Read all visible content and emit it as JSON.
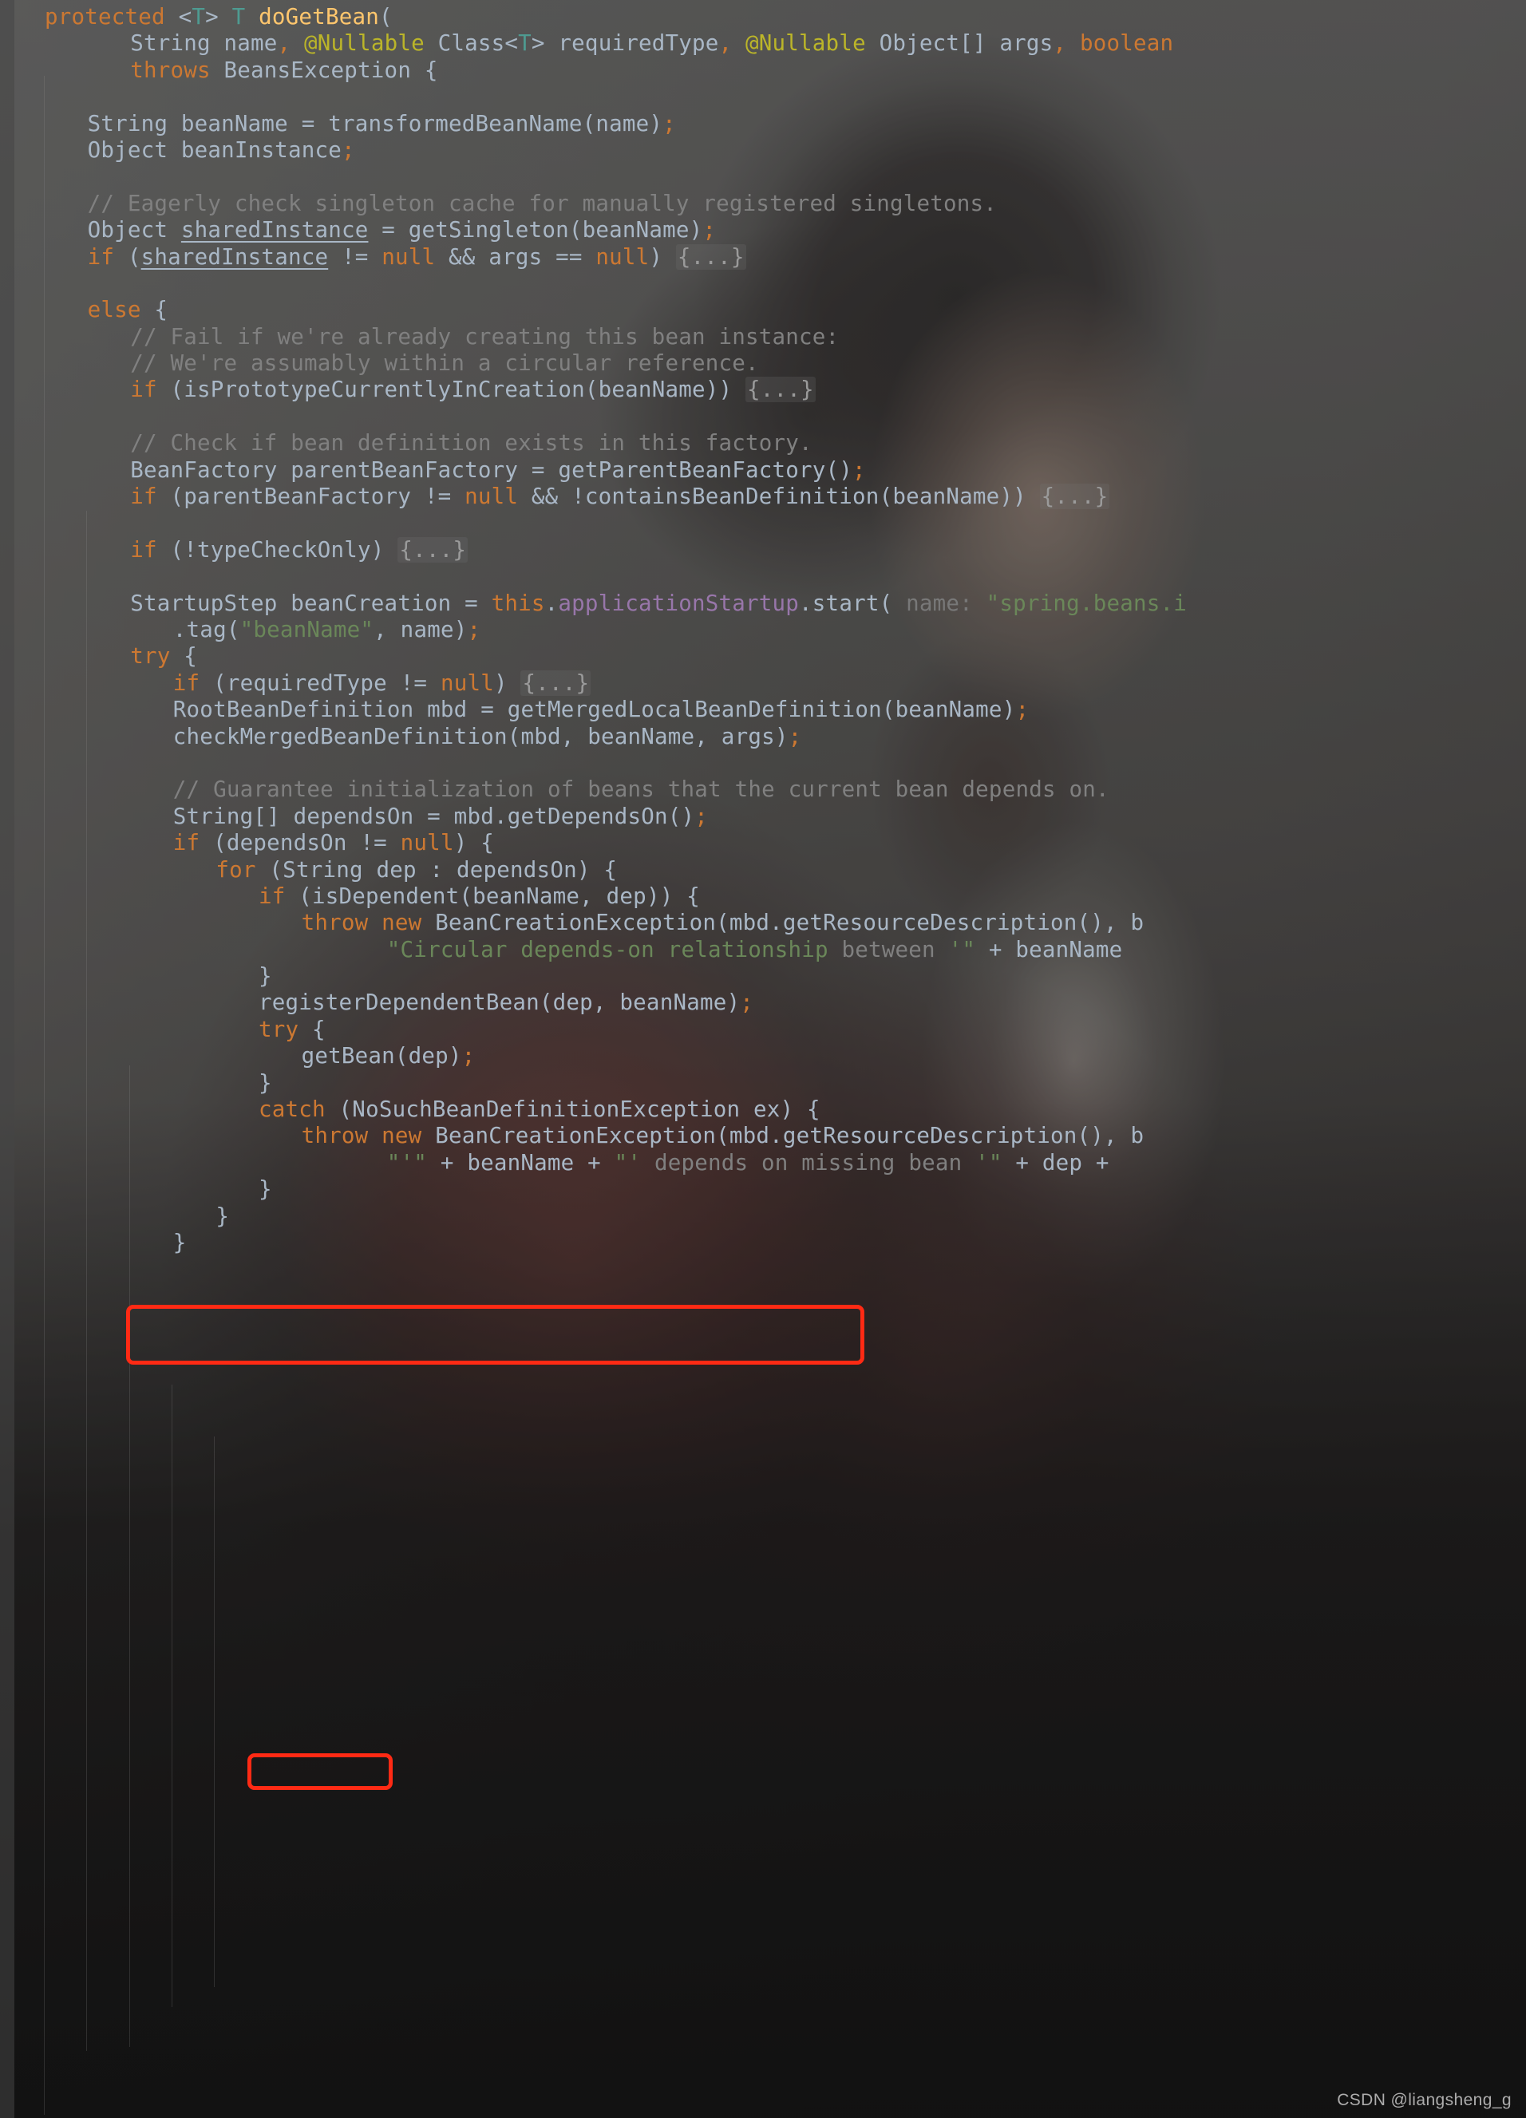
{
  "app": {
    "kind": "code-editor",
    "language": "Java",
    "theme": "Darcula",
    "watermark": "CSDN @liangsheng_g"
  },
  "colors": {
    "background": "#3c3f41",
    "default_text": "#a9b7c6",
    "keyword": "#cc7832",
    "method": "#ffc66d",
    "annotation": "#bbb529",
    "comment": "#808080",
    "string": "#6a8759",
    "field": "#9876aa",
    "type": "#4e9b91",
    "highlight_box": "#ff2a14"
  },
  "annotations": [
    {
      "name": "dependson-highlight",
      "label": "red box around depends-on comment and getDependsOn call",
      "color": "#ff2a14"
    },
    {
      "name": "getbean-highlight",
      "label": "red box around getBean(dep); call",
      "color": "#ff2a14"
    }
  ],
  "code": {
    "lines": [
      {
        "i": 0,
        "indent": 0,
        "tokens": [
          {
            "t": "protected ",
            "c": "kw"
          },
          {
            "t": "<",
            "c": "pl"
          },
          {
            "t": "T",
            "c": "typ"
          },
          {
            "t": "> ",
            "c": "pl"
          },
          {
            "t": "T",
            "c": "typ"
          },
          {
            "t": " ",
            "c": "pl"
          },
          {
            "t": "doGetBean",
            "c": "mth"
          },
          {
            "t": "(",
            "c": "pl"
          }
        ]
      },
      {
        "i": 1,
        "indent": 4,
        "tokens": [
          {
            "t": "String name",
            "c": "pl"
          },
          {
            "t": ", ",
            "c": "kw"
          },
          {
            "t": "@Nullable",
            "c": "ann"
          },
          {
            "t": " Class<",
            "c": "pl"
          },
          {
            "t": "T",
            "c": "typ"
          },
          {
            "t": "> requiredType",
            "c": "pl"
          },
          {
            "t": ", ",
            "c": "kw"
          },
          {
            "t": "@Nullable",
            "c": "ann"
          },
          {
            "t": " Object[] args",
            "c": "pl"
          },
          {
            "t": ", ",
            "c": "kw"
          },
          {
            "t": "boolean",
            "c": "kw"
          }
        ]
      },
      {
        "i": 2,
        "indent": 4,
        "tokens": [
          {
            "t": "throws ",
            "c": "kw"
          },
          {
            "t": "BeansException {",
            "c": "pl"
          }
        ]
      },
      {
        "i": 3,
        "indent": 0,
        "tokens": []
      },
      {
        "i": 4,
        "indent": 2,
        "tokens": [
          {
            "t": "String beanName = transformedBeanName(name)",
            "c": "pl"
          },
          {
            "t": ";",
            "c": "kw"
          }
        ]
      },
      {
        "i": 5,
        "indent": 2,
        "tokens": [
          {
            "t": "Object beanInstance",
            "c": "pl"
          },
          {
            "t": ";",
            "c": "kw"
          }
        ]
      },
      {
        "i": 6,
        "indent": 0,
        "tokens": []
      },
      {
        "i": 7,
        "indent": 2,
        "tokens": [
          {
            "t": "// Eagerly check singleton cache for manually registered singletons.",
            "c": "cm"
          }
        ]
      },
      {
        "i": 8,
        "indent": 2,
        "tokens": [
          {
            "t": "Object ",
            "c": "pl"
          },
          {
            "t": "sharedInstance",
            "c": "und"
          },
          {
            "t": " = getSingleton(beanName)",
            "c": "pl"
          },
          {
            "t": ";",
            "c": "kw"
          }
        ]
      },
      {
        "i": 9,
        "indent": 2,
        "tokens": [
          {
            "t": "if",
            "c": "kw"
          },
          {
            "t": " (",
            "c": "pl"
          },
          {
            "t": "sharedInstance",
            "c": "und"
          },
          {
            "t": " != ",
            "c": "pl"
          },
          {
            "t": "null",
            "c": "kw"
          },
          {
            "t": " && args == ",
            "c": "pl"
          },
          {
            "t": "null",
            "c": "kw"
          },
          {
            "t": ") ",
            "c": "pl"
          },
          {
            "t": "{...}",
            "c": "fold"
          }
        ]
      },
      {
        "i": 10,
        "indent": 0,
        "tokens": []
      },
      {
        "i": 11,
        "indent": 2,
        "tokens": [
          {
            "t": "else",
            "c": "kw"
          },
          {
            "t": " {",
            "c": "pl"
          }
        ]
      },
      {
        "i": 12,
        "indent": 4,
        "tokens": [
          {
            "t": "// Fail if we're already creating this bean instance:",
            "c": "cm"
          }
        ]
      },
      {
        "i": 13,
        "indent": 4,
        "tokens": [
          {
            "t": "// We're assumably within a circular reference.",
            "c": "cm"
          }
        ]
      },
      {
        "i": 14,
        "indent": 4,
        "tokens": [
          {
            "t": "if",
            "c": "kw"
          },
          {
            "t": " (isPrototypeCurrentlyInCreation(beanName)) ",
            "c": "pl"
          },
          {
            "t": "{...}",
            "c": "fold"
          }
        ]
      },
      {
        "i": 15,
        "indent": 0,
        "tokens": []
      },
      {
        "i": 16,
        "indent": 4,
        "tokens": [
          {
            "t": "// Check if bean definition exists in this factory.",
            "c": "cm"
          }
        ]
      },
      {
        "i": 17,
        "indent": 4,
        "tokens": [
          {
            "t": "BeanFactory parentBeanFactory = getParentBeanFactory()",
            "c": "pl"
          },
          {
            "t": ";",
            "c": "kw"
          }
        ]
      },
      {
        "i": 18,
        "indent": 4,
        "tokens": [
          {
            "t": "if",
            "c": "kw"
          },
          {
            "t": " (parentBeanFactory != ",
            "c": "pl"
          },
          {
            "t": "null",
            "c": "kw"
          },
          {
            "t": " && !containsBeanDefinition(beanName)) ",
            "c": "pl"
          },
          {
            "t": "{...}",
            "c": "fold"
          }
        ]
      },
      {
        "i": 19,
        "indent": 0,
        "tokens": []
      },
      {
        "i": 20,
        "indent": 4,
        "tokens": [
          {
            "t": "if",
            "c": "kw"
          },
          {
            "t": " (!typeCheckOnly) ",
            "c": "pl"
          },
          {
            "t": "{...}",
            "c": "fold"
          }
        ]
      },
      {
        "i": 21,
        "indent": 0,
        "tokens": []
      },
      {
        "i": 22,
        "indent": 4,
        "tokens": [
          {
            "t": "StartupStep beanCreation = ",
            "c": "pl"
          },
          {
            "t": "this",
            "c": "kw"
          },
          {
            "t": ".",
            "c": "pl"
          },
          {
            "t": "applicationStartup",
            "c": "fld"
          },
          {
            "t": ".start(",
            "c": "pl"
          },
          {
            "t": " name: ",
            "c": "hint"
          },
          {
            "t": "\"spring.beans.i",
            "c": "str"
          }
        ]
      },
      {
        "i": 23,
        "indent": 6,
        "tokens": [
          {
            "t": ".tag(",
            "c": "pl"
          },
          {
            "t": "\"beanName\"",
            "c": "str"
          },
          {
            "t": ", name)",
            "c": "pl"
          },
          {
            "t": ";",
            "c": "kw"
          }
        ]
      },
      {
        "i": 24,
        "indent": 4,
        "tokens": [
          {
            "t": "try",
            "c": "kw"
          },
          {
            "t": " {",
            "c": "pl"
          }
        ]
      },
      {
        "i": 25,
        "indent": 6,
        "tokens": [
          {
            "t": "if",
            "c": "kw"
          },
          {
            "t": " (requiredType != ",
            "c": "pl"
          },
          {
            "t": "null",
            "c": "kw"
          },
          {
            "t": ") ",
            "c": "pl"
          },
          {
            "t": "{...}",
            "c": "fold"
          }
        ]
      },
      {
        "i": 26,
        "indent": 6,
        "tokens": [
          {
            "t": "RootBeanDefinition mbd = getMergedLocalBeanDefinition(beanName)",
            "c": "pl"
          },
          {
            "t": ";",
            "c": "kw"
          }
        ]
      },
      {
        "i": 27,
        "indent": 6,
        "tokens": [
          {
            "t": "checkMergedBeanDefinition(mbd, beanName, args)",
            "c": "pl"
          },
          {
            "t": ";",
            "c": "kw"
          }
        ]
      },
      {
        "i": 28,
        "indent": 0,
        "tokens": []
      },
      {
        "i": 29,
        "indent": 6,
        "tokens": [
          {
            "t": "// Guarantee initialization of beans that the current bean depends on.",
            "c": "cm"
          }
        ]
      },
      {
        "i": 30,
        "indent": 6,
        "tokens": [
          {
            "t": "String[] dependsOn = mbd.getDependsOn()",
            "c": "pl"
          },
          {
            "t": ";",
            "c": "kw"
          }
        ]
      },
      {
        "i": 31,
        "indent": 6,
        "tokens": [
          {
            "t": "if",
            "c": "kw"
          },
          {
            "t": " (dependsOn != ",
            "c": "pl"
          },
          {
            "t": "null",
            "c": "kw"
          },
          {
            "t": ") {",
            "c": "pl"
          }
        ]
      },
      {
        "i": 32,
        "indent": 8,
        "tokens": [
          {
            "t": "for",
            "c": "kw"
          },
          {
            "t": " (String dep : dependsOn) {",
            "c": "pl"
          }
        ]
      },
      {
        "i": 33,
        "indent": 10,
        "tokens": [
          {
            "t": "if",
            "c": "kw"
          },
          {
            "t": " (isDependent(beanName, dep)) {",
            "c": "pl"
          }
        ]
      },
      {
        "i": 34,
        "indent": 12,
        "tokens": [
          {
            "t": "throw",
            "c": "kw"
          },
          {
            "t": " ",
            "c": "pl"
          },
          {
            "t": "new",
            "c": "kw"
          },
          {
            "t": " BeanCreationException(mbd.getResourceDescription(), ",
            "c": "pl"
          },
          {
            "t": "b",
            "c": "pl"
          }
        ]
      },
      {
        "i": 35,
        "indent": 16,
        "tokens": [
          {
            "t": "\"Circular depends-on relationship ",
            "c": "str"
          },
          {
            "t": "between",
            "c": "cm"
          },
          {
            "t": " '\"",
            "c": "str"
          },
          {
            "t": " + beanName",
            "c": "pl"
          }
        ]
      },
      {
        "i": 36,
        "indent": 10,
        "tokens": [
          {
            "t": "}",
            "c": "pl"
          }
        ]
      },
      {
        "i": 37,
        "indent": 10,
        "tokens": [
          {
            "t": "registerDependentBean(dep, beanName)",
            "c": "pl"
          },
          {
            "t": ";",
            "c": "kw"
          }
        ]
      },
      {
        "i": 38,
        "indent": 10,
        "tokens": [
          {
            "t": "try",
            "c": "kw"
          },
          {
            "t": " {",
            "c": "pl"
          }
        ]
      },
      {
        "i": 39,
        "indent": 12,
        "tokens": [
          {
            "t": "getBean(dep)",
            "c": "pl"
          },
          {
            "t": ";",
            "c": "kw"
          }
        ]
      },
      {
        "i": 40,
        "indent": 10,
        "tokens": [
          {
            "t": "}",
            "c": "pl"
          }
        ]
      },
      {
        "i": 41,
        "indent": 10,
        "tokens": [
          {
            "t": "catch",
            "c": "kw"
          },
          {
            "t": " (NoSuchBeanDefinitionException ex) {",
            "c": "pl"
          }
        ]
      },
      {
        "i": 42,
        "indent": 12,
        "tokens": [
          {
            "t": "throw",
            "c": "kw"
          },
          {
            "t": " ",
            "c": "pl"
          },
          {
            "t": "new",
            "c": "kw"
          },
          {
            "t": " BeanCreationException(mbd.getResourceDescription(), ",
            "c": "pl"
          },
          {
            "t": "b",
            "c": "pl"
          }
        ]
      },
      {
        "i": 43,
        "indent": 16,
        "tokens": [
          {
            "t": "\"'\"",
            "c": "str"
          },
          {
            "t": " + beanName + ",
            "c": "pl"
          },
          {
            "t": "\"'",
            "c": "str"
          },
          {
            "t": " depends on missing bean ",
            "c": "cm"
          },
          {
            "t": "'\"",
            "c": "str"
          },
          {
            "t": " + dep +",
            "c": "pl"
          }
        ]
      },
      {
        "i": 44,
        "indent": 10,
        "tokens": [
          {
            "t": "}",
            "c": "pl"
          }
        ]
      },
      {
        "i": 45,
        "indent": 8,
        "tokens": [
          {
            "t": "}",
            "c": "pl"
          }
        ]
      },
      {
        "i": 46,
        "indent": 6,
        "tokens": [
          {
            "t": "}",
            "c": "pl"
          }
        ]
      }
    ]
  }
}
